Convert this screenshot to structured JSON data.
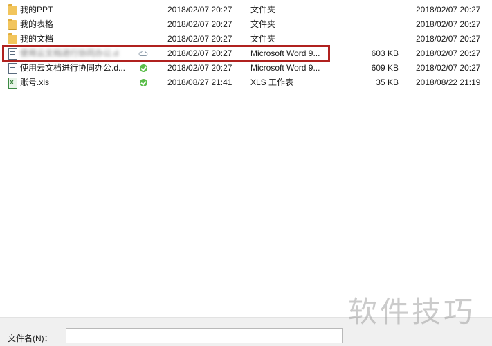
{
  "files": [
    {
      "icon": "folder-icon",
      "name": "我的PPT",
      "status": "",
      "modified": "2018/02/07 20:27",
      "type": "文件夹",
      "size": "",
      "created": "2018/02/07 20:27"
    },
    {
      "icon": "folder-icon",
      "name": "我的表格",
      "status": "",
      "modified": "2018/02/07 20:27",
      "type": "文件夹",
      "size": "",
      "created": "2018/02/07 20:27"
    },
    {
      "icon": "folder-icon",
      "name": "我的文档",
      "status": "",
      "modified": "2018/02/07 20:27",
      "type": "文件夹",
      "size": "",
      "created": "2018/02/07 20:27"
    },
    {
      "icon": "word-doc-icon",
      "name": "使用云文档进行协同办公.d",
      "status": "cloud-icon",
      "modified": "2018/02/07 20:27",
      "type": "Microsoft Word 9...",
      "size": "603 KB",
      "created": "2018/02/07 20:27"
    },
    {
      "icon": "word-doc-icon",
      "name": "使用云文档进行协同办公.d...",
      "status": "synced-check-icon",
      "modified": "2018/02/07 20:27",
      "type": "Microsoft Word 9...",
      "size": "609 KB",
      "created": "2018/02/07 20:27"
    },
    {
      "icon": "excel-icon",
      "name": "账号.xls",
      "status": "synced-check-icon",
      "modified": "2018/08/27 21:41",
      "type": "XLS 工作表",
      "size": "35 KB",
      "created": "2018/08/22 21:19"
    }
  ],
  "footer": {
    "filename_label": "文件名(N)：",
    "filename_value": ""
  },
  "watermark": "软件技巧",
  "colors": {
    "highlight": "#b0211f",
    "synced": "#5bbd4a"
  }
}
